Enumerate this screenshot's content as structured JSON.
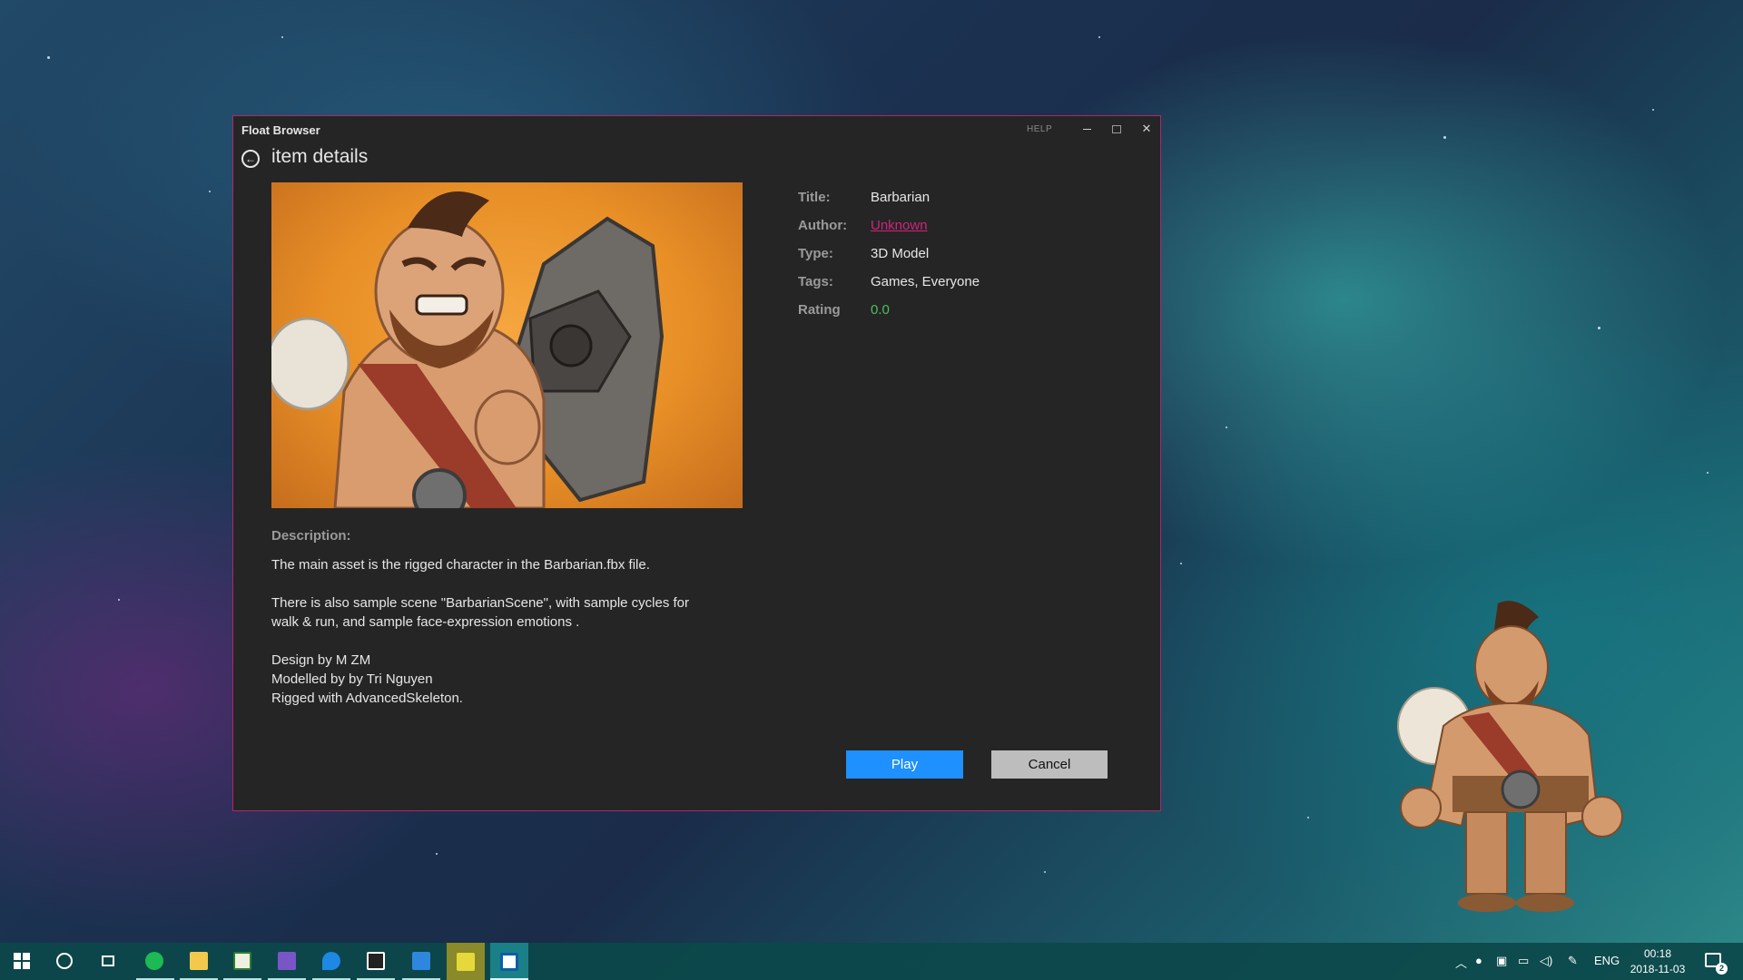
{
  "window": {
    "app_title": "Float Browser",
    "help_label": "HELP",
    "page_title": "item details",
    "accent_color": "#b1266b"
  },
  "item": {
    "labels": {
      "title": "Title:",
      "author": "Author:",
      "type": "Type:",
      "tags": "Tags:",
      "rating": "Rating"
    },
    "title": "Barbarian",
    "author": "Unknown",
    "type": "3D Model",
    "tags": "Games, Everyone",
    "rating": "0.0",
    "preview_image": "barbarian-character-render",
    "description_label": "Description:",
    "description": [
      "The main asset is the rigged character in the Barbarian.fbx file.",
      "There is also sample scene \"BarbarianScene\", with sample cycles for\nwalk & run, and sample face-expression emotions .",
      "Design by M ZM\nModelled by by Tri Nguyen\nRigged with AdvancedSkeleton."
    ]
  },
  "buttons": {
    "play": "Play",
    "cancel": "Cancel",
    "play_color": "#1e90ff"
  },
  "taskbar": {
    "pinned": [
      "windows-start-icon",
      "cortana-search-icon",
      "task-view-icon",
      "spotify-icon",
      "file-explorer-icon",
      "spreadsheet-app-icon",
      "visual-studio-icon",
      "maps-icon",
      "unity-icon",
      "notes-app-icon",
      "float-player-icon",
      "float-browser-icon"
    ],
    "language": "ENG",
    "time": "00:18",
    "date": "2018-11-03",
    "notification_count": "2"
  }
}
